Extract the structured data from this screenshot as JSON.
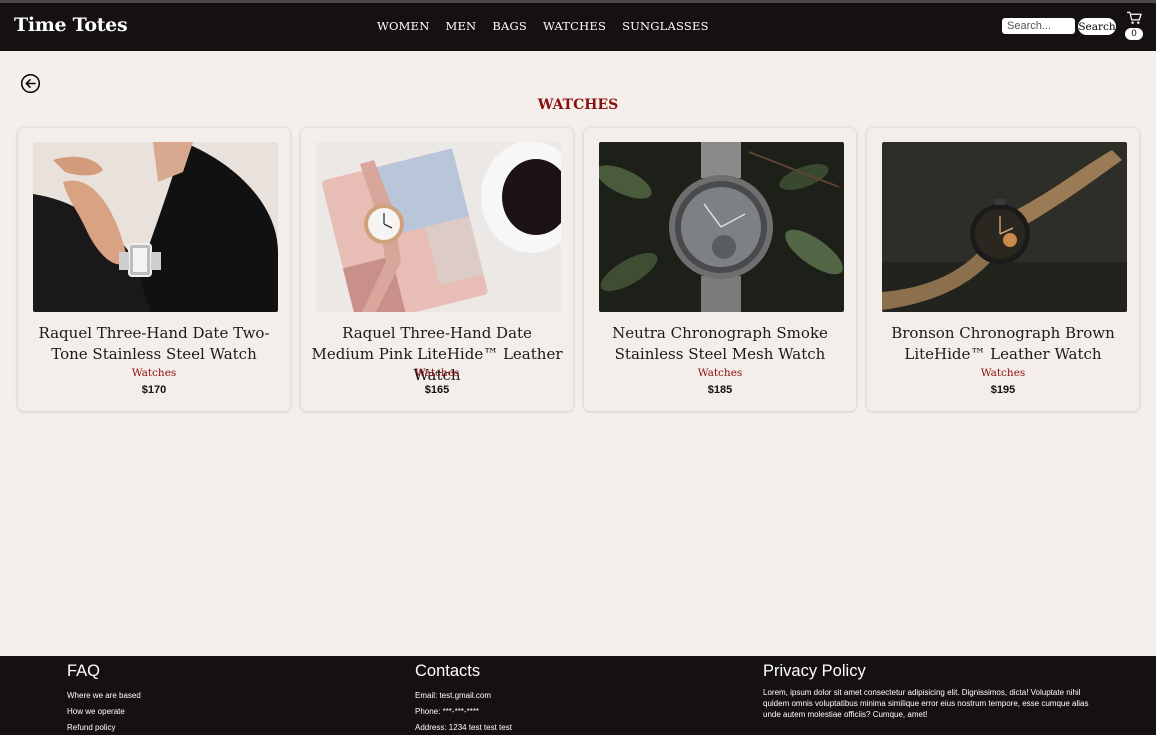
{
  "header": {
    "brand": "Time Totes",
    "nav": [
      "WOMEN",
      "MEN",
      "BAGS",
      "WATCHES",
      "SUNGLASSES"
    ],
    "search_placeholder": "Search...",
    "search_button": "Search",
    "cart_count": "0"
  },
  "page": {
    "title": "WATCHES"
  },
  "products": [
    {
      "name": "Raquel Three-Hand Date Two-Tone Stainless Steel Watch",
      "category": "Watches",
      "price": "$170"
    },
    {
      "name": "Raquel Three-Hand Date Medium Pink LiteHide™ Leather Watch",
      "category": "Watches",
      "price": "$165"
    },
    {
      "name": "Neutra Chronograph Smoke Stainless Steel Mesh Watch",
      "category": "Watches",
      "price": "$185"
    },
    {
      "name": "Bronson Chronograph Brown LiteHide™ Leather Watch",
      "category": "Watches",
      "price": "$195"
    }
  ],
  "footer": {
    "faq": {
      "title": "FAQ",
      "links": [
        "Where we are based",
        "How we operate",
        "Refund policy"
      ]
    },
    "contacts": {
      "title": "Contacts",
      "lines": [
        "Email: test.gmail.com",
        "Phone: ***-***-****",
        "Address: 1234 test test test"
      ]
    },
    "privacy": {
      "title": "Privacy Policy",
      "text": "Lorem, ipsum dolor sit amet consectetur adipisicing elit. Dignissimos, dicta! Voluptate nihil quidem omnis voluptatibus minima similique error eius nostrum tempore, esse cumque alias unde autem molestiae officiis? Cumque, amet!"
    }
  },
  "icons": {
    "back": "back-arrow-circle-icon",
    "cart": "shopping-cart-icon"
  },
  "colors": {
    "header_bg": "#141110",
    "page_bg": "#f5efec",
    "accent": "#8b0e0e"
  }
}
